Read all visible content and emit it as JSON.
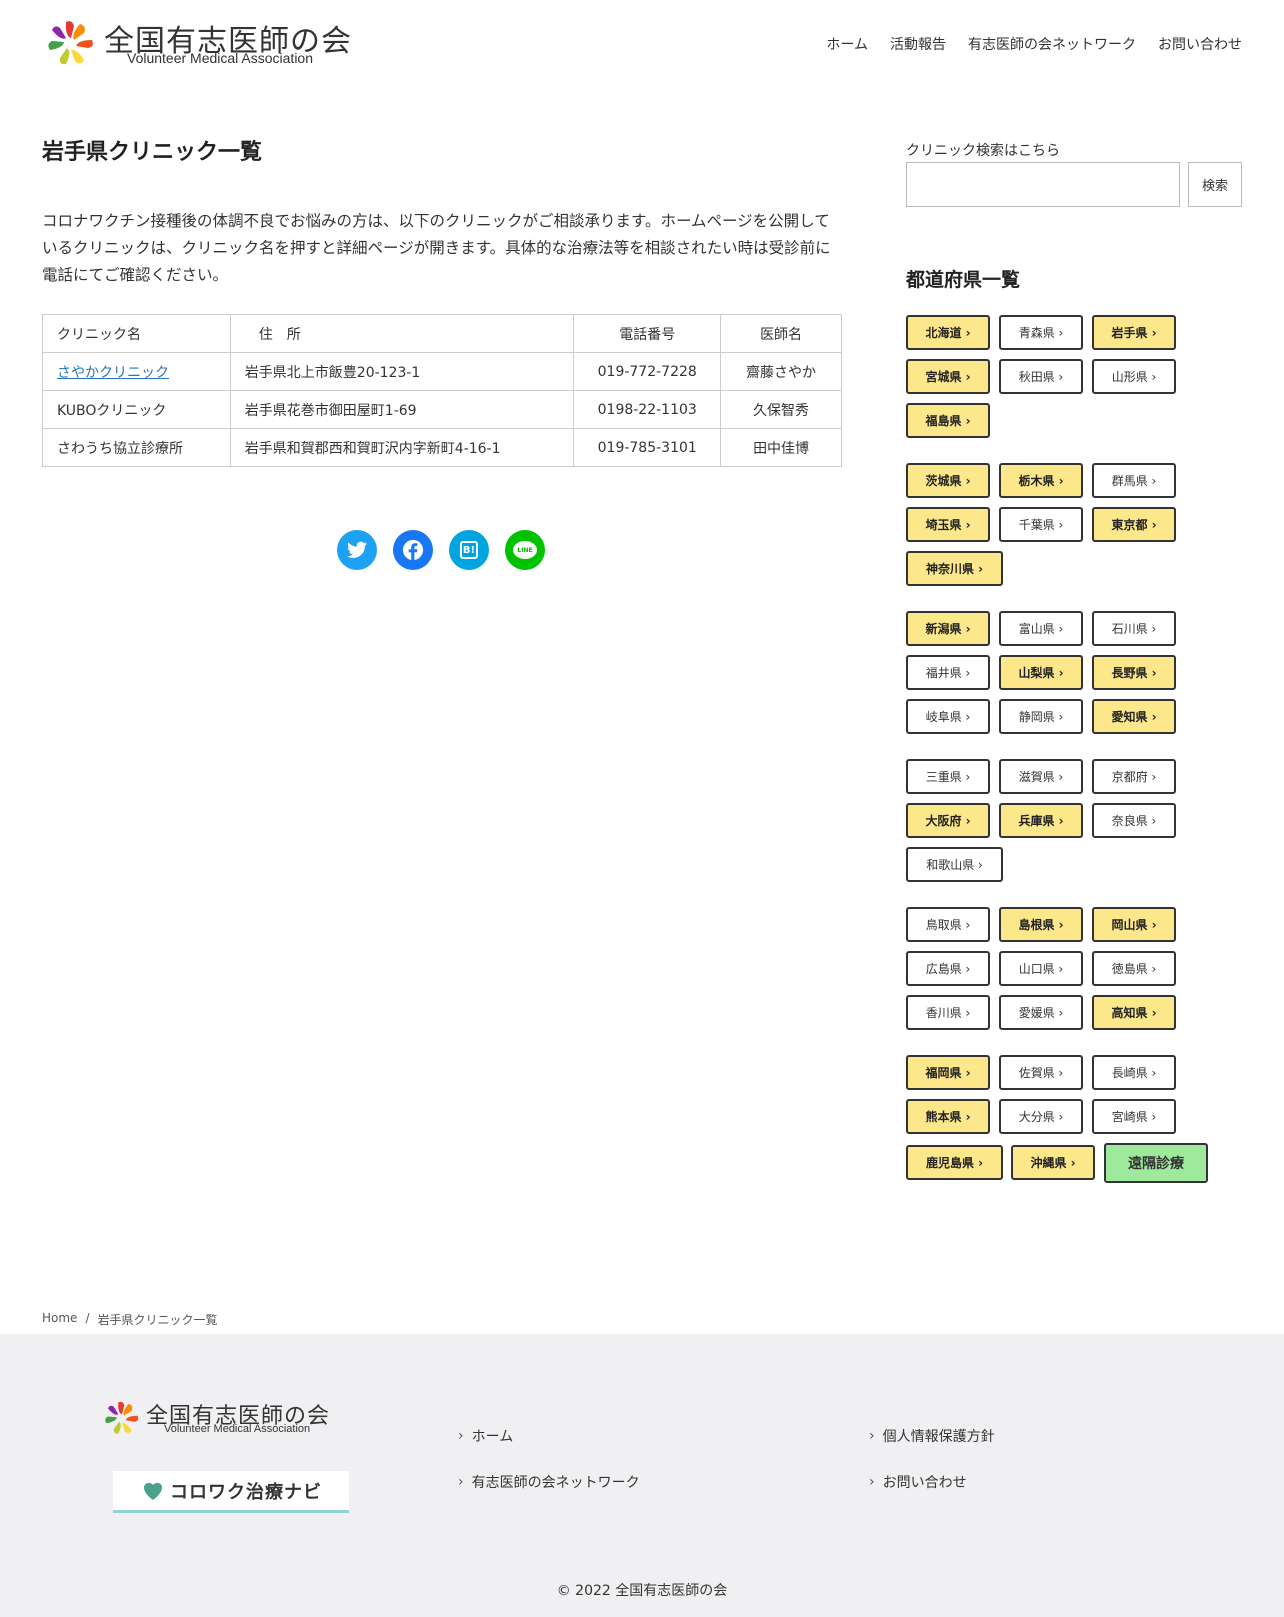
{
  "site": {
    "name_jp": "全国有志医師の会",
    "name_en": "Volunteer Medical Association"
  },
  "nav": [
    "ホーム",
    "活動報告",
    "有志医師の会ネットワーク",
    "お問い合わせ"
  ],
  "page": {
    "title": "岩手県クリニック一覧",
    "intro": "コロナワクチン接種後の体調不良でお悩みの方は、以下のクリニックがご相談承ります。ホームページを公開しているクリニックは、クリニック名を押すと詳細ページが開きます。具体的な治療法等を相談されたい時は受診前に電話にてご確認ください。"
  },
  "table": {
    "headers": [
      "クリニック名",
      "住　所",
      "電話番号",
      "医師名"
    ],
    "rows": [
      {
        "name": "さやかクリニック",
        "address": "岩手県北上市飯豊20-123-1",
        "phone": "019-772-7228",
        "doctor": "齋藤さやか"
      },
      {
        "name": "KUBOクリニック",
        "address": "岩手県花巻市御田屋町1-69",
        "phone": "0198-22-1103",
        "doctor": "久保智秀"
      },
      {
        "name": "さわうち協立診療所",
        "address": "岩手県和賀郡西和賀町沢内字新町4-16-1",
        "phone": "019-785-3101",
        "doctor": "田中佳博"
      }
    ]
  },
  "share": {
    "icons": [
      "twitter-icon",
      "facebook-icon",
      "hatena-icon",
      "line-icon"
    ],
    "colors": [
      "#1da1f2",
      "#1877f2",
      "#00a4de",
      "#00c300"
    ],
    "hatena_label": "B!",
    "line_label": "LINE"
  },
  "sidebar": {
    "search_label": "クリニック検索はこちら",
    "search_button": "検索",
    "pref_title": "都道府県一覧",
    "prefectures": [
      {
        "label": "北海道 ›",
        "hl": true
      },
      {
        "label": "青森県 ›",
        "hl": false
      },
      {
        "label": "岩手県 ›",
        "hl": true
      },
      {
        "label": "宮城県 ›",
        "hl": true
      },
      {
        "label": "秋田県 ›",
        "hl": false
      },
      {
        "label": "山形県 ›",
        "hl": false
      },
      {
        "label": "福島県 ›",
        "hl": true
      },
      {
        "label": "茨城県 ›",
        "hl": true
      },
      {
        "label": "栃木県 ›",
        "hl": true
      },
      {
        "label": "群馬県 ›",
        "hl": false
      },
      {
        "label": "埼玉県 ›",
        "hl": true
      },
      {
        "label": "千葉県 ›",
        "hl": false
      },
      {
        "label": "東京都 ›",
        "hl": true
      },
      {
        "label": "神奈川県 ›",
        "hl": true
      },
      {
        "label": "新潟県 ›",
        "hl": true
      },
      {
        "label": "富山県 ›",
        "hl": false
      },
      {
        "label": "石川県 ›",
        "hl": false
      },
      {
        "label": "福井県 ›",
        "hl": false
      },
      {
        "label": "山梨県 ›",
        "hl": true
      },
      {
        "label": "長野県 ›",
        "hl": true
      },
      {
        "label": "岐阜県 ›",
        "hl": false
      },
      {
        "label": "静岡県 ›",
        "hl": false
      },
      {
        "label": "愛知県 ›",
        "hl": true
      },
      {
        "label": "三重県 ›",
        "hl": false
      },
      {
        "label": "滋賀県 ›",
        "hl": false
      },
      {
        "label": "京都府 ›",
        "hl": false
      },
      {
        "label": "大阪府 ›",
        "hl": true
      },
      {
        "label": "兵庫県 ›",
        "hl": true
      },
      {
        "label": "奈良県 ›",
        "hl": false
      },
      {
        "label": "和歌山県 ›",
        "hl": false
      },
      {
        "label": "鳥取県 ›",
        "hl": false
      },
      {
        "label": "島根県 ›",
        "hl": true
      },
      {
        "label": "岡山県 ›",
        "hl": true
      },
      {
        "label": "広島県 ›",
        "hl": false
      },
      {
        "label": "山口県 ›",
        "hl": false
      },
      {
        "label": "徳島県 ›",
        "hl": false
      },
      {
        "label": "香川県 ›",
        "hl": false
      },
      {
        "label": "愛媛県 ›",
        "hl": false
      },
      {
        "label": "高知県 ›",
        "hl": true
      },
      {
        "label": "福岡県 ›",
        "hl": true
      },
      {
        "label": "佐賀県 ›",
        "hl": false
      },
      {
        "label": "長崎県 ›",
        "hl": false
      },
      {
        "label": "熊本県 ›",
        "hl": true
      },
      {
        "label": "大分県 ›",
        "hl": false
      },
      {
        "label": "宮崎県 ›",
        "hl": false
      },
      {
        "label": "鹿児島県 ›",
        "hl": true
      },
      {
        "label": "沖縄県 ›",
        "hl": true
      }
    ],
    "remote_label": "遠隔診療",
    "highlight_color": "#fce88a",
    "remote_color": "#9ee99c"
  },
  "breadcrumb": {
    "home": "Home",
    "sep": "/",
    "current": "岩手県クリニック一覧"
  },
  "footer": {
    "banner_text": "コロワク治療ナビ",
    "links": [
      "ホーム",
      "有志医師の会ネットワーク",
      "個人情報保護方針",
      "お問い合わせ"
    ],
    "copyright": "© 2022 全国有志医師の会"
  }
}
